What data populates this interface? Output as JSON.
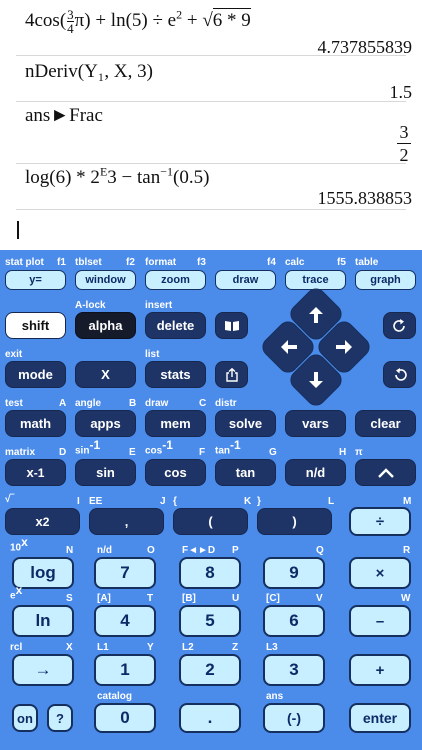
{
  "history": {
    "entries": [
      {
        "expr_parts": {
          "a": "4",
          "b": "cos(",
          "num": "3",
          "den": "4",
          "c": "π) + ln(5) ÷ e",
          "sup": "2",
          "d": " + ",
          "e": "6 * 9"
        },
        "result": "4.737855839"
      },
      {
        "expr": "nDeriv(Y₁, X, 3)",
        "result": "1.5"
      },
      {
        "expr": "ans►Frac",
        "result_num": "3",
        "result_den": "2"
      },
      {
        "expr_parts": {
          "a": "log(6) * 2",
          "sup": "E",
          "b": "3 − tan",
          "sup2": "−1",
          "c": "(0.5)"
        },
        "result": "1555.838853"
      }
    ]
  },
  "keypad": {
    "labels": {
      "stat_plot": "stat plot",
      "f1": "f1",
      "tblset": "tblset",
      "f2": "f2",
      "format": "format",
      "f3": "f3",
      "f4": "f4",
      "calc": "calc",
      "f5": "f5",
      "table": "table",
      "a_lock": "A-lock",
      "insert": "insert",
      "exit": "exit",
      "list": "list",
      "test": "test",
      "A": "A",
      "angle": "angle",
      "B": "B",
      "draw": "draw",
      "C": "C",
      "distr": "distr",
      "matrix": "matrix",
      "D": "D",
      "sin_inv": "sin",
      "E": "E",
      "cos_inv": "cos",
      "F": "F",
      "tan_inv": "tan",
      "G": "G",
      "H": "H",
      "pi": "π",
      "sup_inv": "-1",
      "sqrt": "√‾",
      "I": "I",
      "EE": "EE",
      "J": "J",
      "lbrace": "{",
      "K": "K",
      "rbrace": "}",
      "L": "L",
      "M": "M",
      "ten_x": "10",
      "x_sup": "x",
      "N": "N",
      "nd": "n/d",
      "O": "O",
      "fdf": "F◄►D",
      "P": "P",
      "Q": "Q",
      "R": "R",
      "e_x": "e",
      "S": "S",
      "Abr": "[A]",
      "T": "T",
      "Bbr": "[B]",
      "U": "U",
      "Cbr": "[C]",
      "V": "V",
      "W": "W",
      "rcl": "rcl",
      "X": "X",
      "L1": "L1",
      "Y": "Y",
      "L2": "L2",
      "Z": "Z",
      "L3": "L3",
      "catalog": "catalog",
      "ans": "ans"
    },
    "keys": {
      "y_eq": "y=",
      "window": "window",
      "zoom": "zoom",
      "draw": "draw",
      "trace": "trace",
      "graph": "graph",
      "shift": "shift",
      "alpha": "alpha",
      "delete": "delete",
      "mode": "mode",
      "x": "X",
      "stats": "stats",
      "math": "math",
      "apps": "apps",
      "mem": "mem",
      "solve": "solve",
      "vars": "vars",
      "clear": "clear",
      "xinv": "x",
      "xinv_sup": "-1",
      "sin": "sin",
      "cos": "cos",
      "tan": "tan",
      "nd": "n/d",
      "caret": "^",
      "x2": "x",
      "x2_sup": "2",
      "comma": ",",
      "lparen": "(",
      "rparen": ")",
      "divide": "÷",
      "log": "log",
      "seven": "7",
      "eight": "8",
      "nine": "9",
      "times": "×",
      "ln": "ln",
      "four": "4",
      "five": "5",
      "six": "6",
      "minus": "–",
      "store": "→",
      "one": "1",
      "two": "2",
      "three": "3",
      "plus": "+",
      "on": "on",
      "help": "?",
      "zero": "0",
      "dot": ".",
      "neg": "(-)",
      "enter": "enter"
    }
  }
}
